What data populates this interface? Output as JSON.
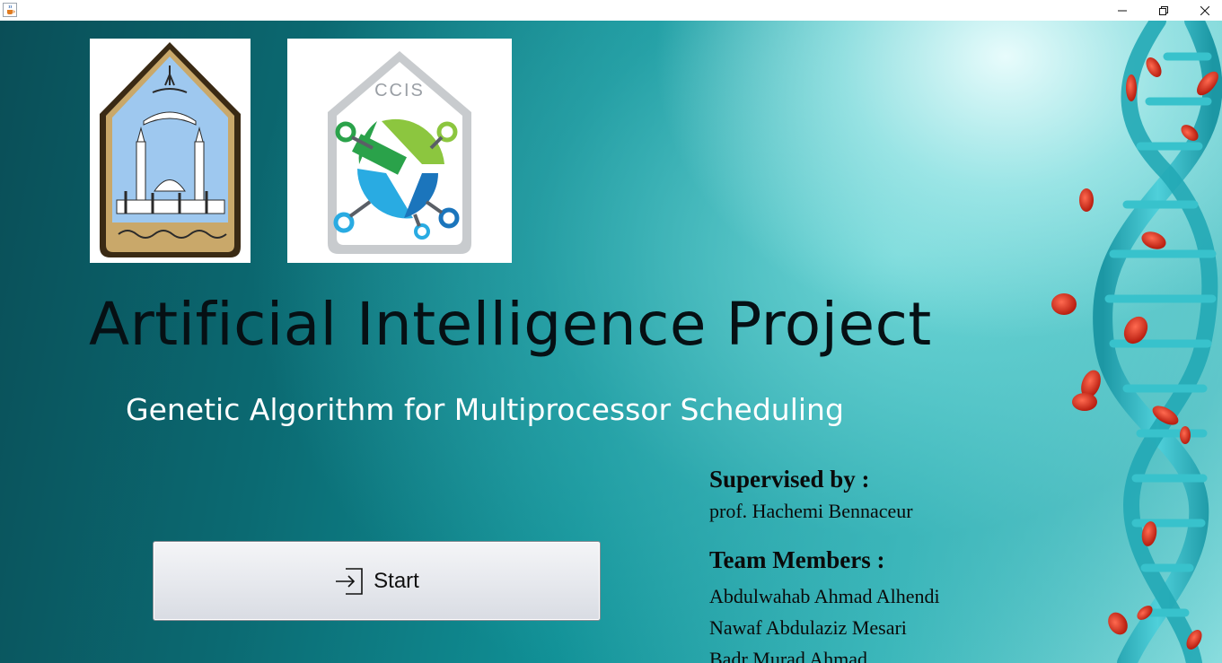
{
  "window": {
    "icons": {
      "app": "java-cup-icon",
      "minimize": "minimize-icon",
      "maximize": "restore-icon",
      "close": "close-icon"
    }
  },
  "logos": {
    "university": {
      "icon": "imam-university-emblem"
    },
    "college": {
      "icon": "ccis-logo",
      "text": "CCIS"
    }
  },
  "main": {
    "title": "Artificial Intelligence Project",
    "subtitle": "Genetic Algorithm for Multiprocessor Scheduling",
    "start_button": {
      "label": "Start",
      "icon": "sign-in-icon"
    }
  },
  "credits": {
    "supervised_heading": "Supervised by :",
    "supervisor": "prof. Hachemi Bennaceur",
    "team_heading": "Team Members :",
    "members": [
      "Abdulwahab Ahmad Alhendi",
      "Nawaf Abdulaziz Mesari",
      "Badr Murad Ahmad"
    ]
  },
  "decoration": {
    "icon": "dna-helix-illustration"
  },
  "colors": {
    "background_dark": "#0a4e57",
    "background_light": "#8edfe0",
    "title": "#061014",
    "subtitle": "#ffffff",
    "dna": "#2fb8c4",
    "blood_cell": "#d8321f"
  }
}
